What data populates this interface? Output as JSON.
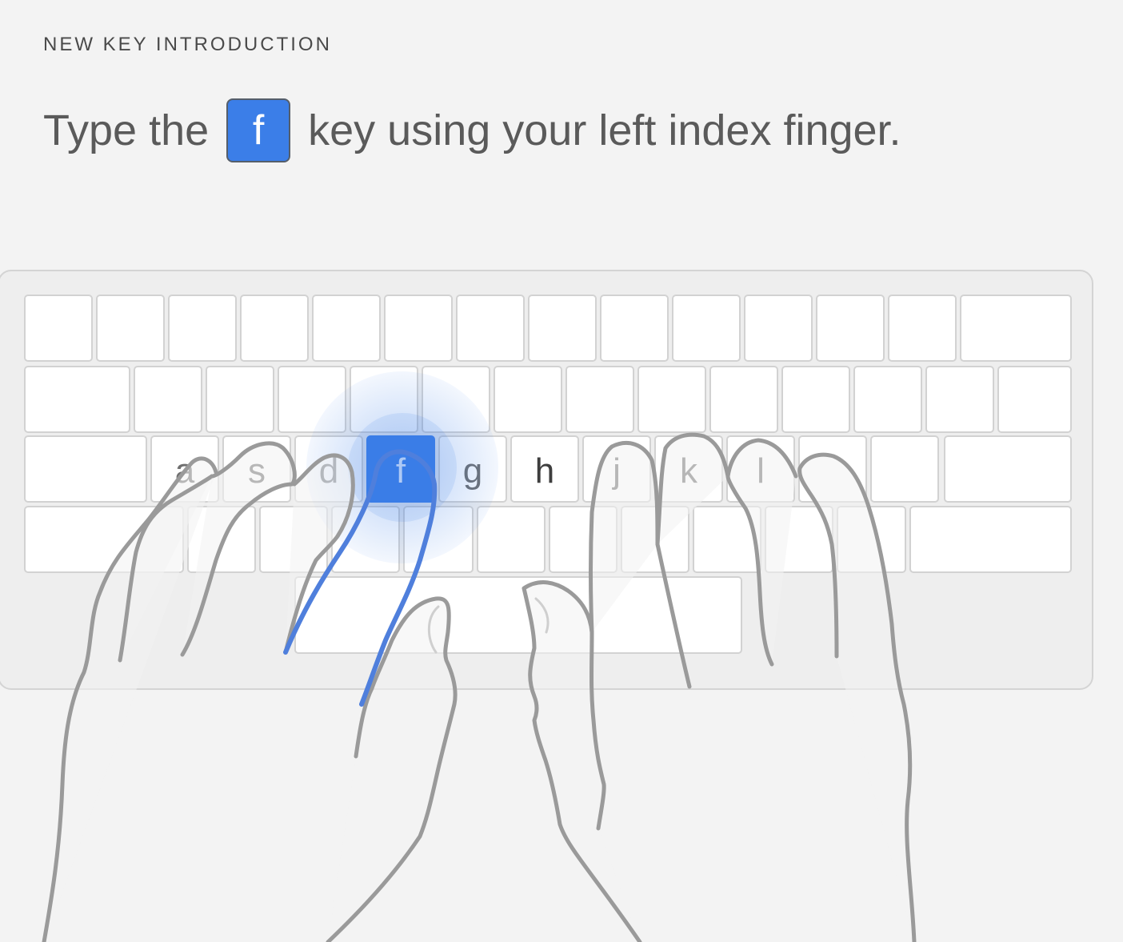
{
  "eyebrow": "NEW KEY INTRODUCTION",
  "instruction": {
    "before": "Type the",
    "key": "f",
    "after": "key using your left index finger."
  },
  "keyboard": {
    "home_row_labels": [
      "a",
      "s",
      "d",
      "f",
      "g",
      "h",
      "j",
      "k",
      "l"
    ],
    "highlighted_key": "f"
  },
  "colors": {
    "accent": "#3b7ee8",
    "finger_highlight": "#4f7fdc",
    "hand_outline": "#999999",
    "background": "#f3f3f3"
  }
}
